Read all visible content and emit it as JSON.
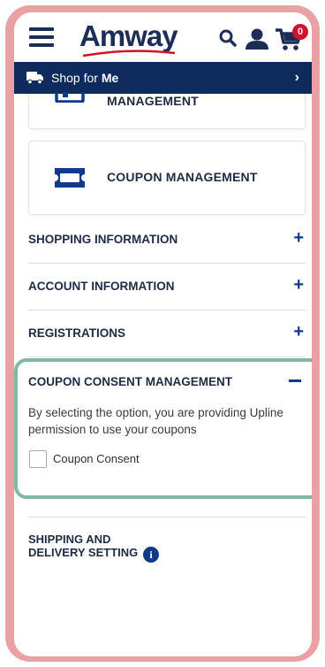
{
  "header": {
    "logo_text": "Amway",
    "cart_count": "0",
    "icons": [
      "hamburger-menu-icon",
      "search-icon",
      "account-icon",
      "cart-icon"
    ]
  },
  "shop_bar": {
    "prefix": "Shop for ",
    "target": "Me",
    "icon": "truck-icon",
    "chevron": "›"
  },
  "cards": {
    "top_partial_label": "MANAGEMENT",
    "coupon_label": "COUPON MANAGEMENT"
  },
  "sections": [
    {
      "title": "SHOPPING INFORMATION",
      "toggle": "+"
    },
    {
      "title": "ACCOUNT INFORMATION",
      "toggle": "+"
    },
    {
      "title": "REGISTRATIONS",
      "toggle": "+"
    }
  ],
  "consent": {
    "title": "COUPON CONSENT MANAGEMENT",
    "description": "By selecting the option, you are providing Upline permission to use your coupons",
    "checkbox_label": "Coupon Consent",
    "checked": false
  },
  "shipping": {
    "line1": "SHIPPING AND",
    "line2": "DELIVERY SETTING",
    "info_glyph": "i"
  },
  "colors": {
    "frame": "#eaa1a3",
    "highlight": "#7fb8a3",
    "navy": "#0f2a5c",
    "accent_blue": "#0f3a8a",
    "badge_red": "#d0142c"
  }
}
